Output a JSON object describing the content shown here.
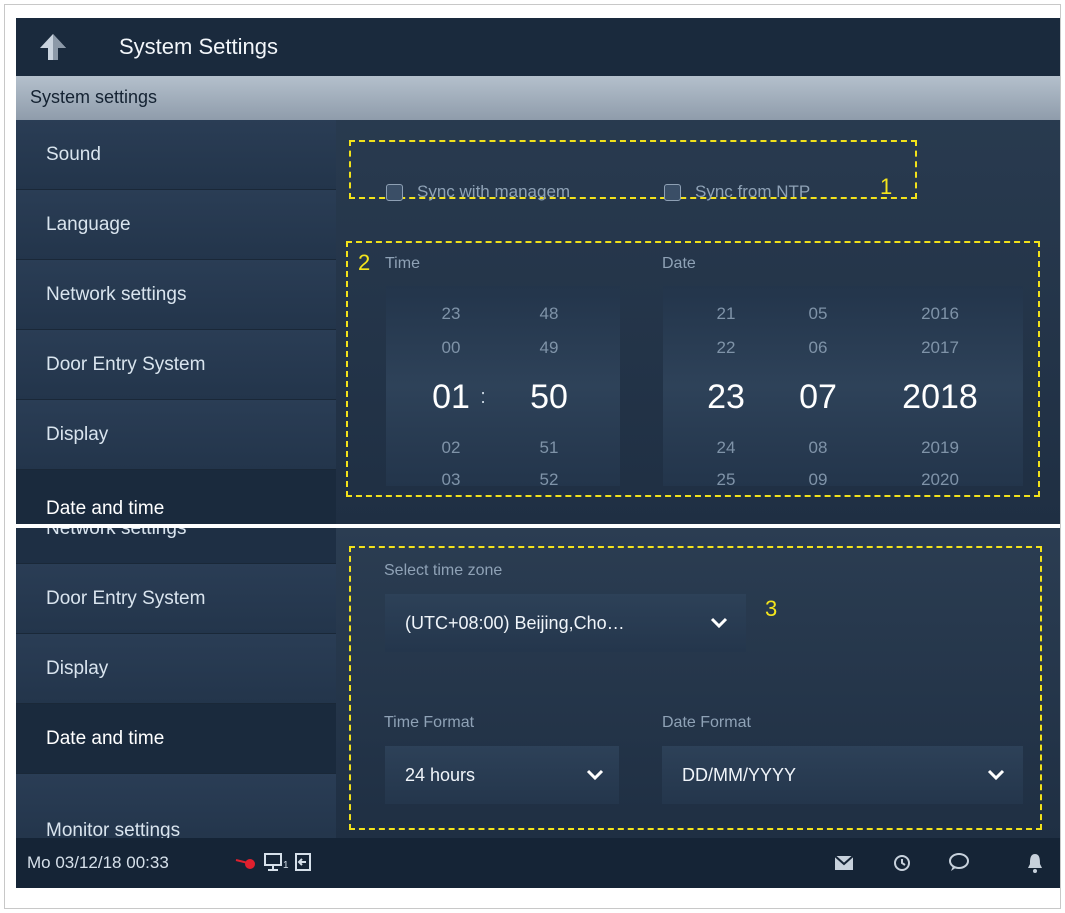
{
  "header": {
    "title": "System Settings"
  },
  "subheader": {
    "label": "System settings"
  },
  "sidebar_top": {
    "items": [
      {
        "label": "Sound"
      },
      {
        "label": "Language"
      },
      {
        "label": "Network settings"
      },
      {
        "label": "Door Entry System"
      },
      {
        "label": "Display"
      },
      {
        "label": "Date and time"
      }
    ]
  },
  "sidebar_bottom": {
    "items": [
      {
        "label": "Network settings"
      },
      {
        "label": "Door Entry System"
      },
      {
        "label": "Display"
      },
      {
        "label": "Date and time"
      },
      {
        "label": "Monitor settings"
      }
    ]
  },
  "sync": {
    "management_label": "Sync with managem",
    "ntp_label": "Sync from NTP",
    "management_checked": false,
    "ntp_checked": false
  },
  "annotations": {
    "n1": "1",
    "n2": "2",
    "n3": "3"
  },
  "time_picker": {
    "label": "Time",
    "separator": ":",
    "hours": [
      "23",
      "00",
      "01",
      "02",
      "03"
    ],
    "minutes": [
      "48",
      "49",
      "50",
      "51",
      "52"
    ]
  },
  "date_picker": {
    "label": "Date",
    "days": [
      "21",
      "22",
      "23",
      "24",
      "25"
    ],
    "months": [
      "05",
      "06",
      "07",
      "08",
      "09"
    ],
    "years": [
      "2016",
      "2017",
      "2018",
      "2019",
      "2020"
    ]
  },
  "timezone": {
    "label": "Select time zone",
    "value": "(UTC+08:00) Beijing,Cho…"
  },
  "time_format": {
    "label": "Time Format",
    "value": "24 hours"
  },
  "date_format": {
    "label": "Date Format",
    "value": "DD/MM/YYYY"
  },
  "statusbar": {
    "datetime": "Mo 03/12/18  00:33",
    "monitor_index": "1"
  },
  "colors": {
    "accent": "#f5e51c",
    "background": "#1f2f43",
    "status_dot": "#e0202e"
  }
}
